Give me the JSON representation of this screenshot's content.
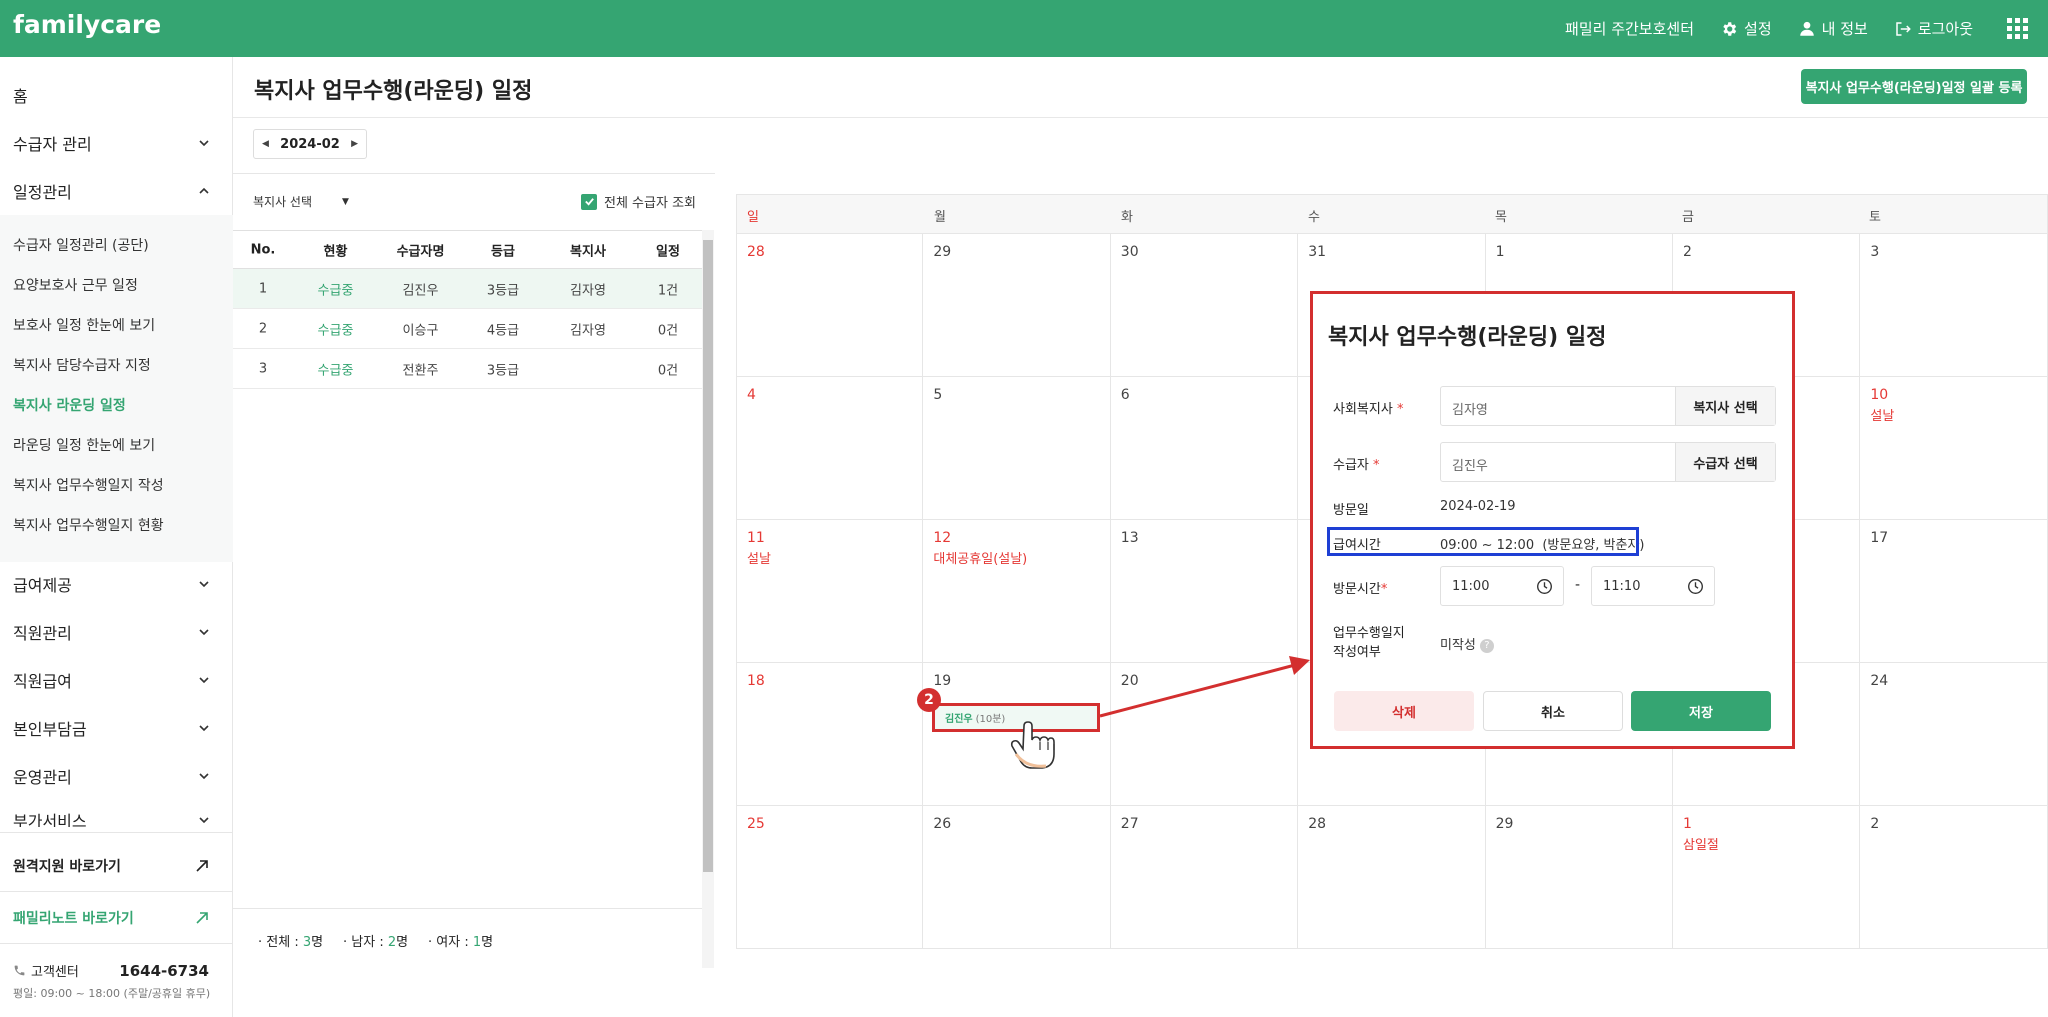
{
  "header": {
    "logo": "familycare",
    "center_name": "패밀리 주간보호센터",
    "settings": "설정",
    "my_info": "내 정보",
    "logout": "로그아웃"
  },
  "sidebar": {
    "home": "홈",
    "menus": [
      "수급자 관리",
      "일정관리",
      "급여제공",
      "직원관리",
      "직원급여",
      "본인부담금",
      "운영관리",
      "부가서비스"
    ],
    "sub_items": [
      "수급자 일정관리 (공단)",
      "요양보호사 근무 일정",
      "보호사 일정 한눈에 보기",
      "복지사 담당수급자 지정",
      "복지사 라운딩 일정",
      "라운딩 일정 한눈에 보기",
      "복지사 업무수행일지 작성",
      "복지사 업무수행일지 현황"
    ],
    "remote_support": "원격지원 바로가기",
    "family_note": "패밀리노트 바로가기",
    "cs_label": "고객센터",
    "cs_phone": "1644-6734",
    "cs_hours": "평일: 09:00 ~ 18:00 (주말/공휴일 휴무)"
  },
  "page": {
    "title": "복지사 업무수행(라운딩) 일정",
    "bulk_button": "복지사 업무수행(라운딩)일정 일괄 등록",
    "month": "2024-02"
  },
  "list": {
    "worker_select": "복지사 선택",
    "view_all": "전체 수급자 조회",
    "headers": [
      "No.",
      "현황",
      "수급자명",
      "등급",
      "복지사",
      "일정"
    ],
    "rows": [
      [
        "1",
        "수급중",
        "김진우",
        "3등급",
        "김자영",
        "1건"
      ],
      [
        "2",
        "수급중",
        "이승구",
        "4등급",
        "김자영",
        "0건"
      ],
      [
        "3",
        "수급중",
        "전환주",
        "3등급",
        "",
        "0건"
      ]
    ],
    "footer": {
      "total_label": "전체 : ",
      "total_value": "3",
      "total_unit": "명",
      "male_label": "남자 : ",
      "male_value": "2",
      "male_unit": "명",
      "female_label": "여자 : ",
      "female_value": "1",
      "female_unit": "명"
    }
  },
  "calendar": {
    "weekdays": [
      "일",
      "월",
      "화",
      "수",
      "목",
      "금",
      "토"
    ],
    "weeks": [
      [
        {
          "d": "28"
        },
        {
          "d": "29"
        },
        {
          "d": "30"
        },
        {
          "d": "31"
        },
        {
          "d": "1"
        },
        {
          "d": "2"
        },
        {
          "d": "3"
        }
      ],
      [
        {
          "d": "4"
        },
        {
          "d": "5"
        },
        {
          "d": "6"
        },
        {
          "d": ""
        },
        {
          "d": ""
        },
        {
          "d": ""
        },
        {
          "d": "10",
          "h": "설날"
        }
      ],
      [
        {
          "d": "11",
          "h": "설날"
        },
        {
          "d": "12",
          "h": "대체공휴일(설날)"
        },
        {
          "d": "13"
        },
        {
          "d": ""
        },
        {
          "d": ""
        },
        {
          "d": ""
        },
        {
          "d": "17"
        }
      ],
      [
        {
          "d": "18"
        },
        {
          "d": "19"
        },
        {
          "d": "20"
        },
        {
          "d": ""
        },
        {
          "d": ""
        },
        {
          "d": ""
        },
        {
          "d": "24"
        }
      ],
      [
        {
          "d": "25"
        },
        {
          "d": "26"
        },
        {
          "d": "27"
        },
        {
          "d": "28"
        },
        {
          "d": "29"
        },
        {
          "d": "1",
          "h": "삼일절"
        },
        {
          "d": "2"
        }
      ]
    ],
    "event": {
      "name": "김진우",
      "duration": "(10분)"
    },
    "step_badge": "2"
  },
  "modal": {
    "title": "복지사 업무수행(라운딩) 일정",
    "worker_label": "사회복지사",
    "worker_value": "김자영",
    "worker_button": "복지사 선택",
    "recipient_label": "수급자",
    "recipient_value": "김진우",
    "recipient_button": "수급자 선택",
    "visit_date_label": "방문일",
    "visit_date_value": "2024-02-19",
    "service_time_label": "급여시간",
    "service_time_value": "09:00 ~ 12:00  (방문요양, 박춘자)",
    "visit_time_label": "방문시간",
    "visit_time_start": "11:00",
    "visit_time_end": "11:10",
    "journal_label_1": "업무수행일지",
    "journal_label_2": "작성여부",
    "journal_value": "미작성",
    "delete": "삭제",
    "cancel": "취소",
    "save": "저장"
  },
  "colors": {
    "brand": "#35a572",
    "holiday": "#e53935",
    "annotation_red": "#d32f2f",
    "annotation_blue": "#1e3fd4"
  }
}
